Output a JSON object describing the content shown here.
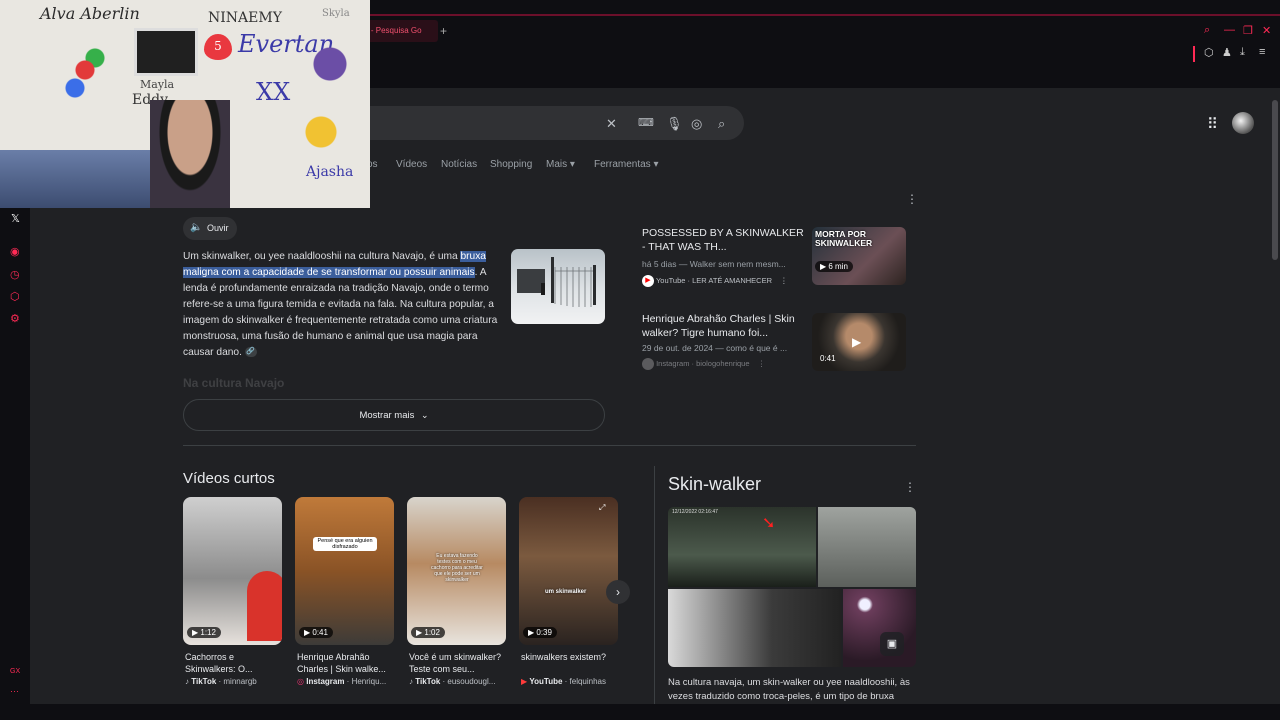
{
  "browser": {
    "tab_title": "r - Pesquisa Go",
    "new_tab": "+"
  },
  "search_nav": [
    "os",
    "Vídeos",
    "Notícias",
    "Shopping",
    "Mais ▾",
    "Ferramentas ▾"
  ],
  "ai_overview": {
    "listen_label": "Ouvir",
    "text_before": "Um skinwalker, ou yee naaldlooshii na cultura Navajo, é uma ",
    "text_highlight": "bruxa maligna com a capacidade de se transformar ou possuir animais",
    "text_after": ". A lenda é profundamente enraizada na tradição Navajo, onde o termo refere-se a uma figura temida e evitada na fala. Na cultura popular, a imagem do skinwalker é frequentemente retratada como uma criatura monstruosa, uma fusão de humano e animal que usa magia para causar dano.",
    "faded_heading": "Na cultura Navajo",
    "show_more": "Mostrar mais"
  },
  "videos": [
    {
      "title": "POSSESSED BY A SKINWALKER - THAT WAS TH...",
      "meta": "há 5 dias — Walker sem nem mesm...",
      "source": "YouTube",
      "channel": "LER ATÉ AMANHECER",
      "duration": "6 min",
      "thumb_text": "MORTA POR SKINWALKER"
    },
    {
      "title": "Henrique Abrahão Charles | Skin walker? Tigre humano foi...",
      "meta": "29 de out. de 2024 — como é que é ...",
      "source": "Instagram",
      "channel": "biologohenrique",
      "duration": "0:41"
    }
  ],
  "shorts": {
    "heading": "Vídeos curtos",
    "items": [
      {
        "title": "Cachorros e Skinwalkers: O...",
        "source": "TikTok",
        "author": "minnargb",
        "duration": "1:12"
      },
      {
        "title": "Henrique Abrahão Charles | Skin walke...",
        "source": "Instagram",
        "author": "Henriqu...",
        "duration": "0:41",
        "overlay": "Pensé que era alguien disfrazado"
      },
      {
        "title": "Você é um skinwalker? Teste com seu...",
        "source": "TikTok",
        "author": "eusoudougl...",
        "duration": "1:02",
        "overlay": "Eu estava fazendo testes com o meu cachorro para acreditar que ele pode ser um skinwalker"
      },
      {
        "title": "skinwalkers existem?",
        "source": "YouTube",
        "author": "felquinhas",
        "duration": "0:39",
        "overlay": "um skinwalker"
      }
    ]
  },
  "knowledge_panel": {
    "title": "Skin-walker",
    "image_timestamp": "12/12/2022 02:16:47",
    "description": "Na cultura navaja, um skin-walker ou yee naaldlooshii, às vezes traduzido como troca-peles, é um tipo de bruxa"
  },
  "webcam": {
    "doodles": [
      "Alva Aberlin",
      "NINAEMY",
      "Evertan",
      "XX",
      "Eddy",
      "Mayla",
      "Ajasha",
      "Skyla"
    ],
    "sticky_number": "5"
  },
  "sidebar_labels": [
    "GX"
  ],
  "icons": {
    "brand_accent": "#ff2a55",
    "highlight": "#3b5e9c"
  }
}
